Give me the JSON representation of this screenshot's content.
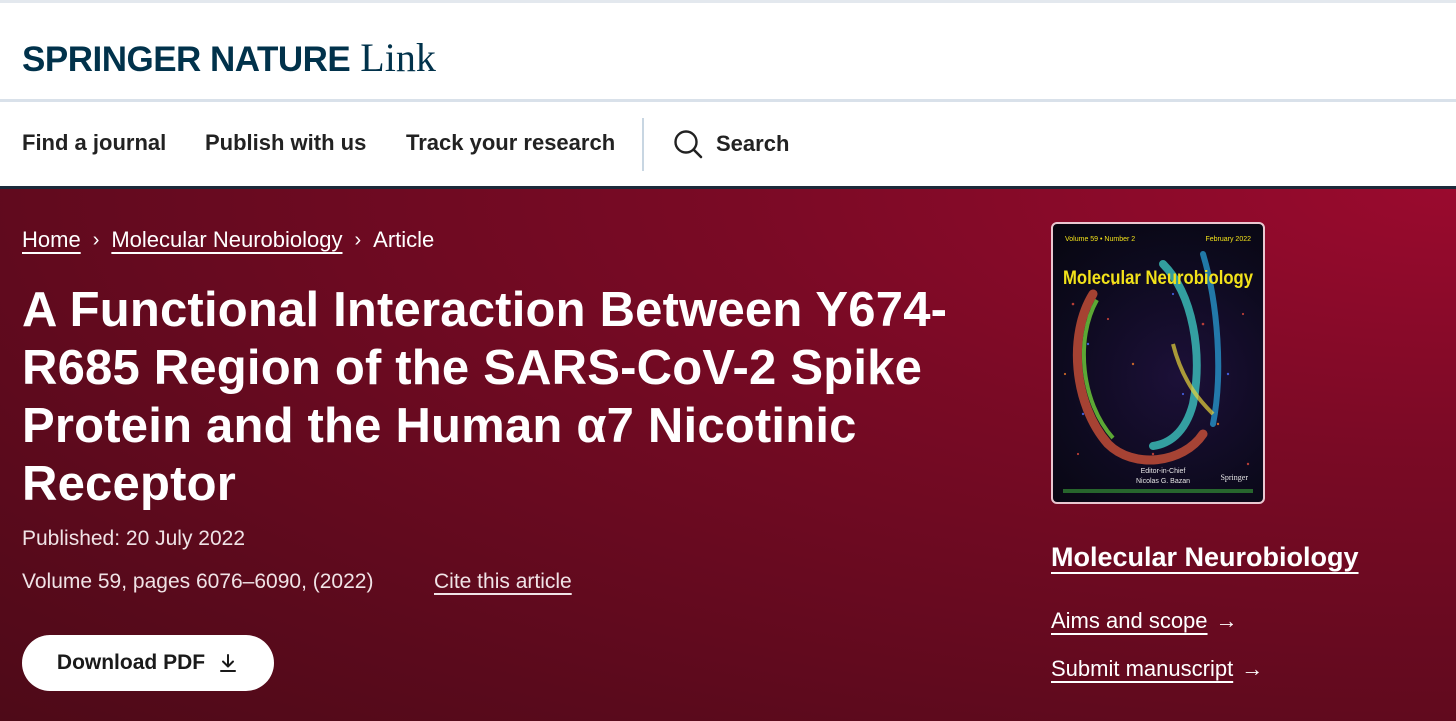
{
  "brand": {
    "name": "SPRINGER NATURE",
    "product": "Link"
  },
  "nav": {
    "items": [
      "Find a journal",
      "Publish with us",
      "Track your research"
    ],
    "search_label": "Search"
  },
  "breadcrumb": {
    "home": "Home",
    "journal": "Molecular Neurobiology",
    "current": "Article"
  },
  "article": {
    "title": "A Functional Interaction Between Y674-R685 Region of the SARS-CoV-2 Spike Protein and the Human α7 Nicotinic Receptor",
    "published": "Published: 20 July 2022",
    "volume": "Volume 59, pages 6076–6090, (2022)",
    "cite_label": "Cite this article",
    "download_label": "Download PDF"
  },
  "cover": {
    "top_left": "Volume 59 • Number 2",
    "top_right": "February 2022",
    "title": "Molecular Neurobiology",
    "editor_label": "Editor-in-Chief",
    "editor_name": "Nicolas G. Bazan",
    "publisher": "Springer"
  },
  "sidebar": {
    "journal_name": "Molecular Neurobiology",
    "aims_label": "Aims and scope",
    "submit_label": "Submit manuscript"
  },
  "colors": {
    "brand": "#01324b",
    "hero": "#7a0a25",
    "cover_title": "#f2e21a"
  },
  "icons": {
    "search": "search-icon",
    "download": "download-icon",
    "chevron": "chevron-right-icon",
    "arrow": "arrow-right-icon"
  }
}
